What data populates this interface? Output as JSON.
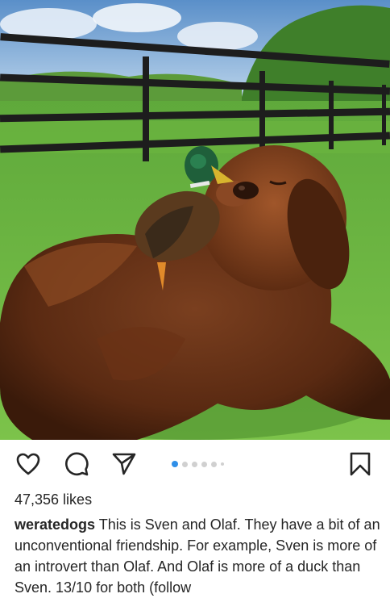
{
  "post": {
    "image_alt": "Brown Newfoundland dog lying on grass with a mallard duck on its back",
    "carousel": {
      "count": 6,
      "active": 1
    },
    "likes": "47,356 likes",
    "caption": {
      "username": "weratedogs",
      "text": "This is Sven and Olaf. They have a bit of an unconventional friendship. For example, Sven is more of an introvert than Olaf. And Olaf is more of a duck than Sven. 13/10 for both (follow"
    }
  },
  "icons": {
    "like": "heart-icon",
    "comment": "comment-bubble-icon",
    "share": "paper-plane-icon",
    "save": "bookmark-icon"
  },
  "colors": {
    "text": "#262626",
    "active_dot": "#2f8fe8",
    "inactive_dot": "#d0d0d0"
  }
}
